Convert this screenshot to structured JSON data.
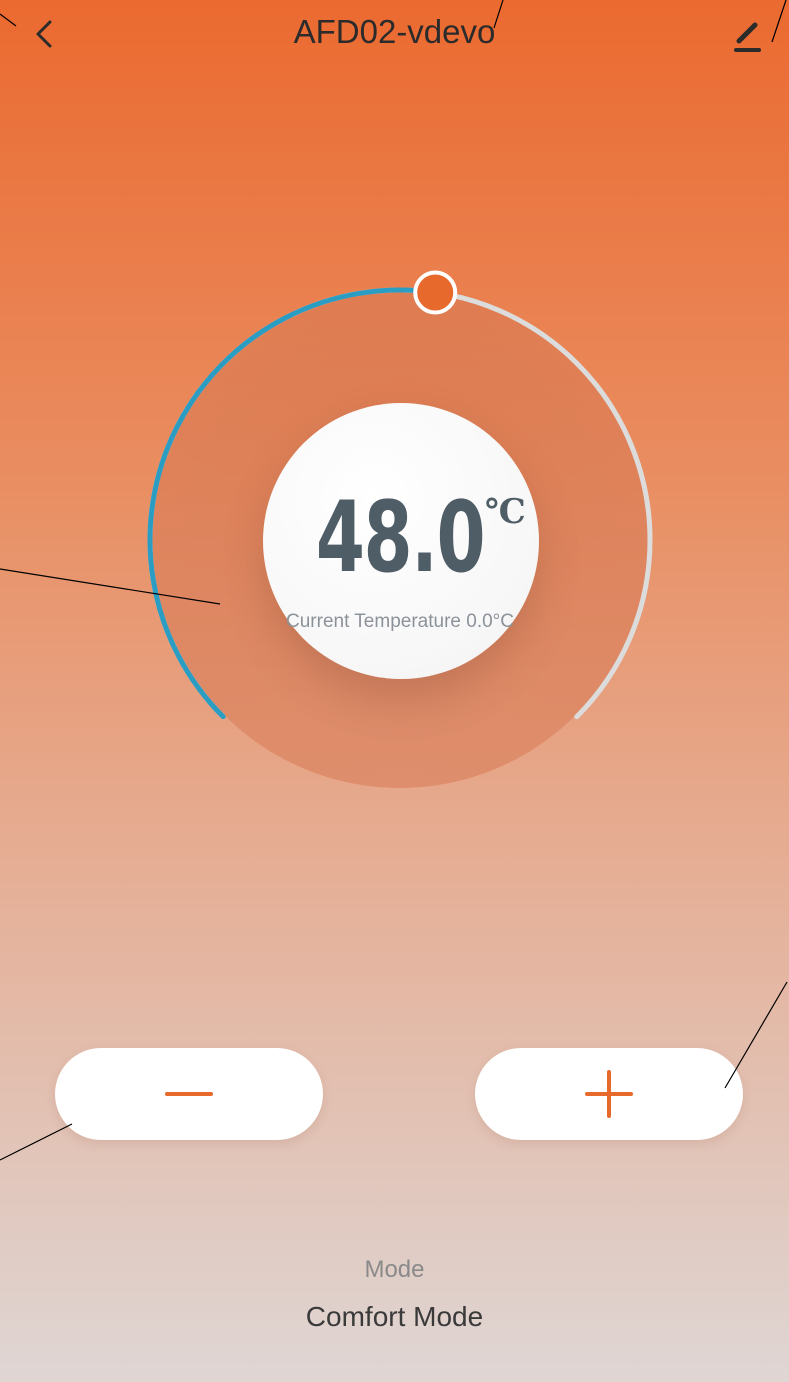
{
  "header": {
    "title": "AFD02-vdevo",
    "back_icon": "chevron-left-icon",
    "edit_icon": "pencil-icon"
  },
  "thermostat": {
    "set_temperature": "48.0",
    "unit": "℃",
    "current_temperature_text": "Current Temperature 0.0°C",
    "progress_fraction": 0.53
  },
  "controls": {
    "decrease_icon": "minus-icon",
    "increase_icon": "plus-icon"
  },
  "mode": {
    "label": "Mode",
    "value": "Comfort Mode"
  },
  "colors": {
    "accent": "#e8692c",
    "arc_active": "#2b9cc2",
    "arc_track": "#dcdcdc",
    "text_dark": "#4f5d66"
  }
}
